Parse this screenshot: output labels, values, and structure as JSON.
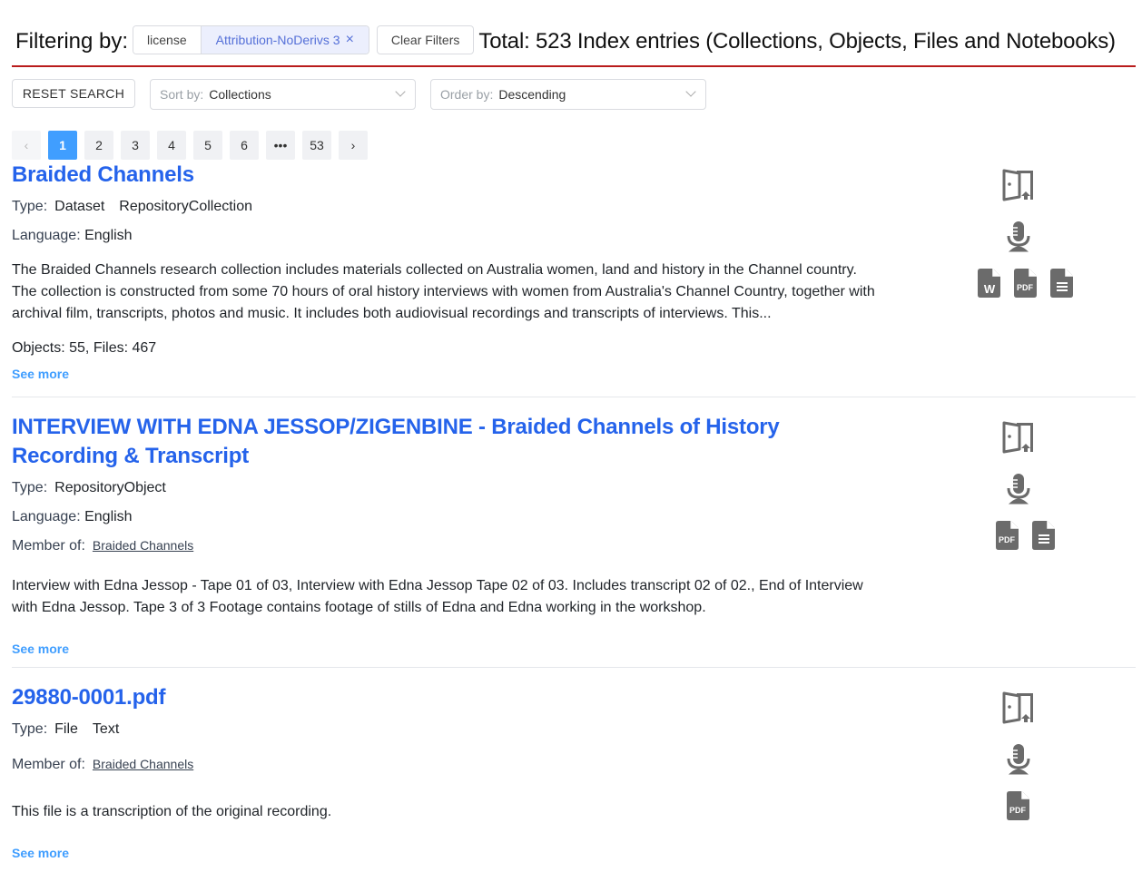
{
  "filter": {
    "label": "Filtering by:",
    "tag_key": "license",
    "tag_value": "Attribution-NoDerivs 3",
    "remove_symbol": "×",
    "clear_label": "Clear Filters",
    "total_text": "Total: 523 Index entries (Collections, Objects, Files and Notebooks)"
  },
  "controls": {
    "reset_label": "RESET SEARCH",
    "sort_label": "Sort by:",
    "sort_value": "Collections",
    "order_label": "Order by:",
    "order_value": "Descending"
  },
  "pagination": {
    "prev": "‹",
    "pages": [
      "1",
      "2",
      "3",
      "4",
      "5",
      "6",
      "•••",
      "53"
    ],
    "current": "1",
    "next": "›"
  },
  "colors": {
    "accent": "#409eff",
    "title_link": "#2563eb",
    "divider_red": "#b91c1c",
    "icon_gray": "#6b6b6b"
  },
  "results": [
    {
      "title": "Braided Channels",
      "type_label": "Type:",
      "types": [
        "Dataset",
        "RepositoryCollection"
      ],
      "language_label": "Language:",
      "language": "English",
      "description": "The Braided Channels research collection includes materials collected on Australia women, land and history in the Channel country. The collection is constructed from some 70 hours of oral history interviews with women from Australia's Channel Country, together with archival film, transcripts, photos and music. It includes both audiovisual recordings and transcripts of interviews. This...",
      "counts": "Objects: 55, Files: 467",
      "see_more": "See more",
      "icons": [
        "open-access-door-icon",
        "microphone-icon",
        "word-file-icon",
        "pdf-file-icon",
        "text-file-icon"
      ]
    },
    {
      "title": "INTERVIEW WITH EDNA JESSOP/ZIGENBINE - Braided Channels of History Recording & Transcript",
      "type_label": "Type:",
      "types": [
        "RepositoryObject"
      ],
      "language_label": "Language:",
      "language": "English",
      "member_label": "Member of:",
      "member_of": "Braided Channels",
      "description": "Interview with Edna Jessop - Tape 01 of 03, Interview with Edna Jessop Tape 02 of 03. Includes transcript 02 of 02., End of Interview with Edna Jessop. Tape 3 of 3 Footage contains footage of stills of Edna and Edna working in the workshop.",
      "see_more": "See more",
      "icons": [
        "open-access-door-icon",
        "microphone-icon",
        "pdf-file-icon",
        "text-file-icon"
      ]
    },
    {
      "title": "29880-0001.pdf",
      "type_label": "Type:",
      "types": [
        "File",
        "Text"
      ],
      "member_label": "Member of:",
      "member_of": "Braided Channels",
      "description": "This file is a transcription of the original recording.",
      "see_more": "See more",
      "icons": [
        "open-access-door-icon",
        "microphone-icon",
        "pdf-file-icon"
      ]
    }
  ]
}
